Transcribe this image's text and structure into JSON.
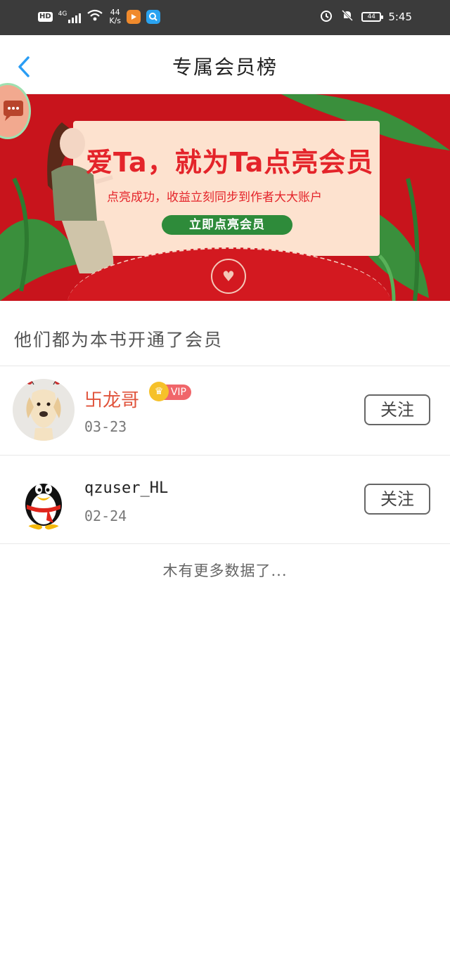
{
  "status_bar": {
    "hd": "HD",
    "signal": "4G",
    "net_speed_value": "44",
    "net_speed_unit": "K/s",
    "battery": "44",
    "time": "5:45"
  },
  "nav": {
    "title": "专属会员榜"
  },
  "banner": {
    "headline": "爱Ta，就为Ta点亮会员",
    "subtitle": "点亮成功，收益立刻同步到作者大大账户",
    "cta": "立即点亮会员"
  },
  "section": {
    "title": "他们都为本书开通了会员"
  },
  "members": [
    {
      "name": "卐龙哥",
      "vip_label": "VIP",
      "date": "03-23",
      "follow_label": "关注"
    },
    {
      "name": "qzuser_HL",
      "date": "02-24",
      "follow_label": "关注"
    }
  ],
  "footer": {
    "no_more": "木有更多数据了..."
  },
  "colors": {
    "banner_red": "#c8141c",
    "headline_red": "#e4242a",
    "cta_green": "#2e8b3a",
    "vip_pink": "#f0666a",
    "back_blue": "#2a9df4"
  },
  "icons": {
    "back": "chevron-left-icon",
    "wifi": "wifi-icon",
    "alarm": "alarm-icon",
    "mute": "bell-off-icon",
    "crown": "crown-icon"
  }
}
